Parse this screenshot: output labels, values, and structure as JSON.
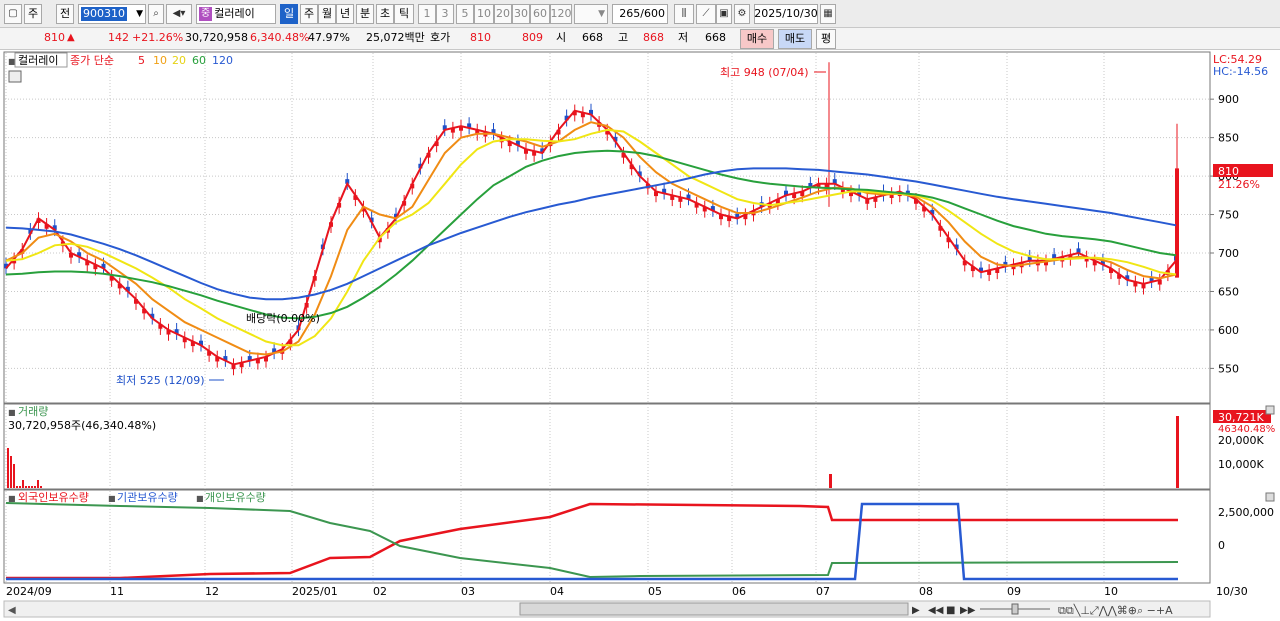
{
  "toolbar": {
    "tabs": [
      "주",
      "전"
    ],
    "code": "900310",
    "stock_name": "컬러레이",
    "name_badge": "중",
    "periods": [
      "일",
      "주",
      "월",
      "년",
      "분",
      "초",
      "틱"
    ],
    "intervals": [
      "1",
      "3",
      "5",
      "10",
      "20",
      "30",
      "60",
      "120"
    ],
    "count": "265",
    "count_total": "/600",
    "date": "2025/10/30"
  },
  "quote": {
    "price": "810",
    "arrow": "▲",
    "change": "142",
    "change_pct": "+21.26%",
    "volume": "30,720,958",
    "volume_pct": "6,340.48%",
    "turnover": "47.97%",
    "amount": "25,072백만",
    "hoga_label": "호가",
    "ask": "810",
    "bid": "809",
    "open_label": "시",
    "open": "668",
    "high_label": "고",
    "high": "868",
    "low_label": "저",
    "low": "668",
    "buy_label": "매수",
    "sell_label": "매도",
    "avg_label": "평"
  },
  "legend": {
    "name": "컬러레이",
    "ma_prefix": "종가 단순",
    "ma_periods": [
      "5",
      "10",
      "20",
      "60",
      "120"
    ],
    "lc": "LC:54.29",
    "hc": "HC:-14.56"
  },
  "annotations": {
    "high": "최고 948 (07/04)",
    "low": "최저 525 (12/09)",
    "dividend": "배당락(0.00%)"
  },
  "price_tag": {
    "price": "810",
    "pct": "21.26%"
  },
  "volume_panel": {
    "title": "거래량",
    "info": "30,720,958주(46,340.48%)",
    "tag": "30,721K",
    "tag_pct": "46340.48%",
    "ticks": [
      "20,000K",
      "10,000K"
    ]
  },
  "holding_panel": {
    "labels": [
      "외국인보유수량",
      "기관보유수량",
      "개인보유수량"
    ],
    "ticks": [
      "2,500,000",
      "0"
    ]
  },
  "x_axis": {
    "labels": [
      "2024/09",
      "11",
      "12",
      "2025/01",
      "02",
      "03",
      "04",
      "05",
      "06",
      "07",
      "08",
      "09",
      "10",
      "10/30"
    ]
  },
  "colors": {
    "up": "#e8141e",
    "down": "#1e50c8",
    "ma5": "#e8141e",
    "ma10": "#f08c14",
    "ma20": "#f0e614",
    "ma60": "#28a03c",
    "ma120": "#285ad2",
    "foreign": "#e8141e",
    "institution": "#285ad2",
    "individual": "#3c9650"
  },
  "chart_data": {
    "type": "line",
    "y_ticks": [
      900,
      850,
      800,
      750,
      700,
      650,
      600,
      550
    ],
    "ylim": [
      505,
      960
    ],
    "x_months": [
      "2024/09",
      "11",
      "12",
      "2025/01",
      "02",
      "03",
      "04",
      "05",
      "06",
      "07",
      "08",
      "09",
      "10"
    ],
    "series": [
      {
        "name": "5",
        "values": [
          680,
          705,
          745,
          730,
          700,
          690,
          680,
          660,
          640,
          615,
          600,
          590,
          580,
          565,
          555,
          560,
          565,
          575,
          600,
          670,
          740,
          790,
          760,
          720,
          745,
          790,
          830,
          860,
          865,
          860,
          855,
          845,
          835,
          830,
          860,
          885,
          880,
          860,
          830,
          800,
          780,
          775,
          770,
          760,
          750,
          745,
          755,
          765,
          775,
          780,
          790,
          790,
          780,
          770,
          775,
          780,
          770,
          750,
          720,
          690,
          675,
          680,
          685,
          690,
          690,
          695,
          700,
          690,
          680,
          665,
          660,
          665,
          690
        ]
      },
      {
        "name": "10",
        "values": [
          690,
          700,
          720,
          725,
          715,
          700,
          690,
          675,
          660,
          640,
          625,
          610,
          600,
          590,
          580,
          570,
          568,
          572,
          585,
          620,
          670,
          730,
          760,
          750,
          745,
          760,
          795,
          830,
          850,
          855,
          855,
          850,
          845,
          838,
          845,
          860,
          870,
          865,
          850,
          825,
          805,
          790,
          780,
          770,
          760,
          752,
          752,
          758,
          765,
          772,
          780,
          785,
          784,
          778,
          776,
          777,
          773,
          760,
          740,
          715,
          695,
          685,
          683,
          686,
          689,
          692,
          695,
          693,
          688,
          678,
          670,
          667,
          672
        ]
      },
      {
        "name": "20",
        "values": [
          690,
          692,
          700,
          710,
          712,
          708,
          700,
          690,
          680,
          668,
          655,
          640,
          628,
          615,
          605,
          595,
          585,
          580,
          580,
          592,
          615,
          650,
          690,
          720,
          740,
          750,
          765,
          790,
          815,
          835,
          845,
          848,
          848,
          846,
          845,
          848,
          855,
          860,
          858,
          845,
          830,
          815,
          800,
          790,
          780,
          770,
          765,
          762,
          765,
          768,
          772,
          776,
          780,
          780,
          778,
          777,
          775,
          768,
          755,
          740,
          725,
          712,
          702,
          696,
          692,
          692,
          693,
          694,
          692,
          688,
          682,
          675,
          672
        ]
      },
      {
        "name": "60",
        "values": [
          672,
          673,
          675,
          676,
          676,
          675,
          673,
          670,
          666,
          662,
          657,
          651,
          645,
          638,
          632,
          626,
          620,
          616,
          615,
          617,
          622,
          630,
          642,
          656,
          672,
          690,
          710,
          730,
          750,
          770,
          788,
          800,
          812,
          820,
          826,
          830,
          832,
          833,
          832,
          830,
          826,
          820,
          814,
          808,
          802,
          797,
          793,
          790,
          788,
          786,
          785,
          784,
          783,
          782,
          780,
          778,
          776,
          772,
          766,
          758,
          750,
          742,
          735,
          730,
          725,
          722,
          720,
          718,
          715,
          710,
          705,
          700,
          697
        ]
      },
      {
        "name": "120",
        "values": [
          733,
          732,
          730,
          728,
          724,
          718,
          712,
          705,
          697,
          688,
          679,
          670,
          661,
          653,
          647,
          642,
          640,
          640,
          642,
          646,
          652,
          660,
          670,
          680,
          690,
          700,
          710,
          718,
          726,
          733,
          740,
          747,
          753,
          758,
          763,
          767,
          772,
          776,
          780,
          784,
          788,
          792,
          797,
          802,
          806,
          809,
          810,
          810,
          810,
          809,
          808,
          806,
          804,
          802,
          799,
          796,
          793,
          789,
          785,
          781,
          777,
          773,
          770,
          767,
          764,
          761,
          758,
          755,
          752,
          748,
          744,
          740,
          736
        ]
      }
    ]
  }
}
